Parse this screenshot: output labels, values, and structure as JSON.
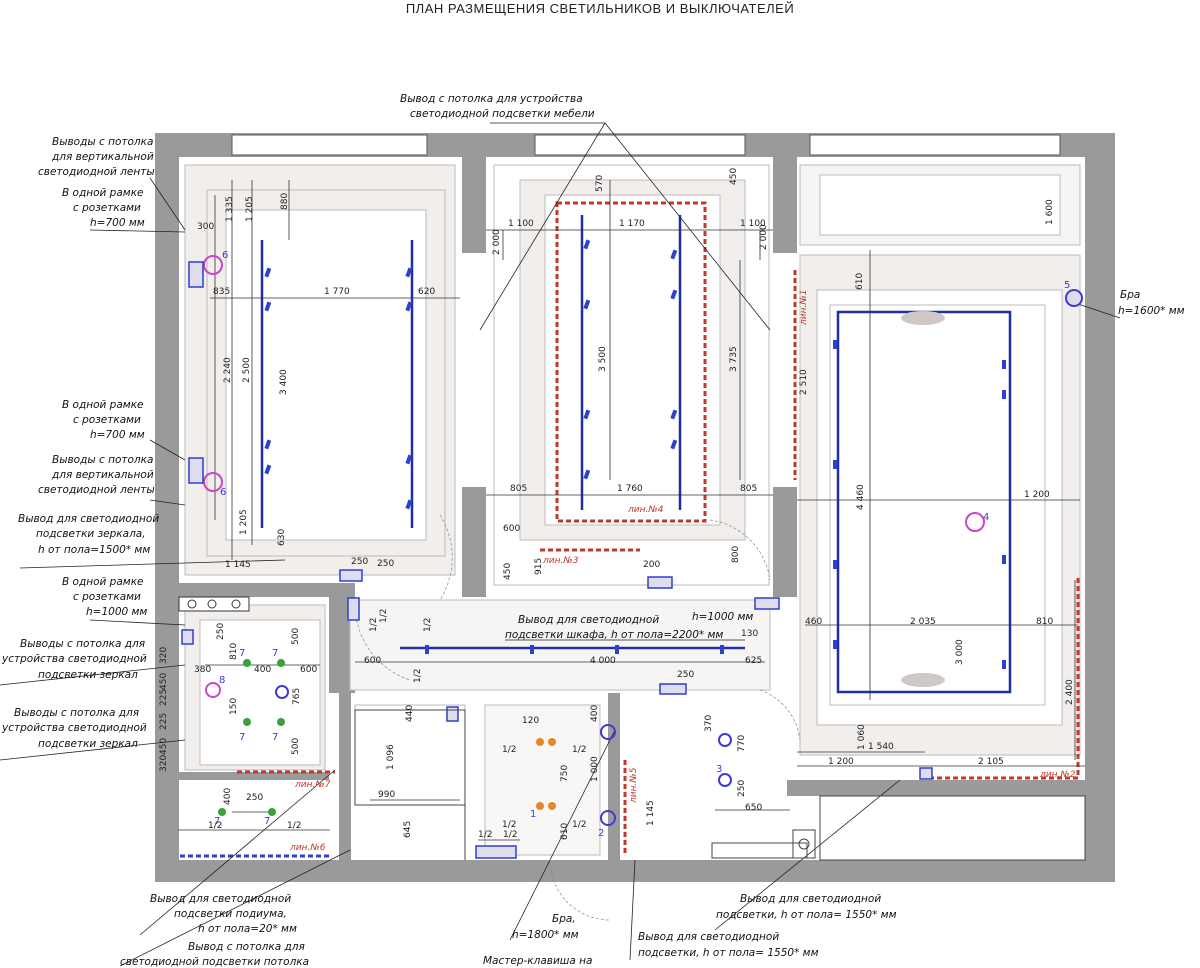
{
  "title": "ПЛАН РАЗМЕЩЕНИЯ СВЕТИЛЬНИКОВ И ВЫКЛЮЧАТЕЛЕЙ",
  "notes": {
    "ceiling_furniture": [
      "Вывод с потолка для  устройства",
      "светодиодной подсветки мебели"
    ],
    "vertical_strip_top": [
      "Выводы с потолка",
      "для вертикальной",
      "светодиодной ленты"
    ],
    "frame_sockets_1": [
      "В одной рамке",
      "с розетками",
      "h=700 мм"
    ],
    "frame_sockets_2": [
      "В одной рамке",
      "с розетками",
      "h=700 мм"
    ],
    "vertical_strip_mid": [
      "Выводы с потолка",
      "для вертикальной",
      "светодиодной ленты"
    ],
    "mirror_led": [
      "Вывод для светодиодной",
      "подсветки зеркала,",
      "h от пола=1500* мм"
    ],
    "frame_sockets_3": [
      "В одной рамке",
      "с розетками",
      "h=1000 мм"
    ],
    "mirror_ceiling_1": [
      "Выводы с потолка для",
      "устройства светодиодной",
      "подсветки зеркал"
    ],
    "mirror_ceiling_2": [
      "Выводы с потолка для",
      "устройства светодиодной",
      "подсветки зеркал"
    ],
    "wardrobe_led": [
      "Вывод для светодиодной",
      "подсветки шкафа, h от пола=2200* мм"
    ],
    "bra_right": [
      "Бра",
      "h=1600* мм"
    ],
    "h1000": "h=1000 мм",
    "podium_led": [
      "Вывод для светодиодной",
      "подсветки подиума,",
      "h от пола=20* мм"
    ],
    "ceiling_led_bottom": [
      "Вывод с потолка для",
      "светодиодной подсветки потолка"
    ],
    "bra_bottom": [
      "Бра,",
      "h=1800* мм"
    ],
    "master_key": "Мастер-клавиша на",
    "led_1550_center": [
      "Вывод для светодиодной",
      "подсветки, h от пола= 1550* мм"
    ],
    "led_1550_right": [
      "Вывод для светодиодной",
      "подсветки, h от пола= 1550* мм"
    ]
  },
  "led_lines": [
    "лин.№1",
    "лин.№2",
    "лин.№3",
    "лин.№4",
    "лин.№5",
    "лин.№6",
    "лин.№7"
  ],
  "fixture_numbers": [
    "1",
    "2",
    "3",
    "4",
    "5",
    "6",
    "6",
    "7",
    "7",
    "7",
    "7",
    "7",
    "7",
    "8"
  ],
  "dimensions": {
    "d300": "300",
    "d1335": "1 335",
    "d1205a": "1 205",
    "d880": "880",
    "d835": "835",
    "d1770": "1 770",
    "d620": "620",
    "d2240": "2 240",
    "d2500": "2 500",
    "d3400": "3 400",
    "d1205b": "1 205",
    "d630": "630",
    "d1145": "1 145",
    "d250a": "250",
    "d1100a": "1 100",
    "d2000a": "2 000",
    "d570": "570",
    "d1170": "1 170",
    "d450a": "450",
    "d1100b": "1 100",
    "d2000b": "2 000",
    "d1600": "1 600",
    "d3500": "3 500",
    "d3735": "3 735",
    "d805a": "805",
    "d1760": "1 760",
    "d805b": "805",
    "d600a": "600",
    "d915": "915",
    "d450b": "450",
    "d200": "200",
    "d800": "800",
    "d610": "610",
    "d2510": "2 510",
    "d4460": "4 460",
    "d1200a": "1 200",
    "d460": "460",
    "d2035": "2 035",
    "d810": "810",
    "d3000": "3 000",
    "d2400": "2 400",
    "d4000": "4 000",
    "d600b": "600",
    "d625": "625",
    "d130": "130",
    "d250b": "250",
    "d250c": "250",
    "d810b": "810",
    "d400a": "400",
    "d600c": "600",
    "d500a": "500",
    "d765": "765",
    "d500b": "500",
    "d380": "380",
    "d150": "150",
    "d320a": "320",
    "d450c": "450",
    "d225a": "225",
    "d225b": "225",
    "d450d": "450",
    "d320b": "320",
    "d440": "440",
    "d1096": "1 096",
    "d990": "990",
    "d645": "645",
    "d120": "120",
    "d750": "750",
    "d610b": "610",
    "d1000": "1 000",
    "d400b": "400",
    "d1145b": "1 145",
    "d370": "370",
    "d770": "770",
    "d250d": "250",
    "d650": "650",
    "d1060": "1 060",
    "d1540": "1 540",
    "d1200b": "1 200",
    "d2105": "2 105",
    "d400c": "400",
    "d250e": "250",
    "d250f": "250",
    "h12": "1/2"
  },
  "colors": {
    "wall": "#9a9a9a",
    "led_line": "#c0392b",
    "track": "#1f2fa8",
    "fixture": "#2f3fd0",
    "sconce": "#cc44cc",
    "spot_green": "#3aa23a",
    "spot_orange": "#e08a2b",
    "dim_line": "#333333"
  }
}
